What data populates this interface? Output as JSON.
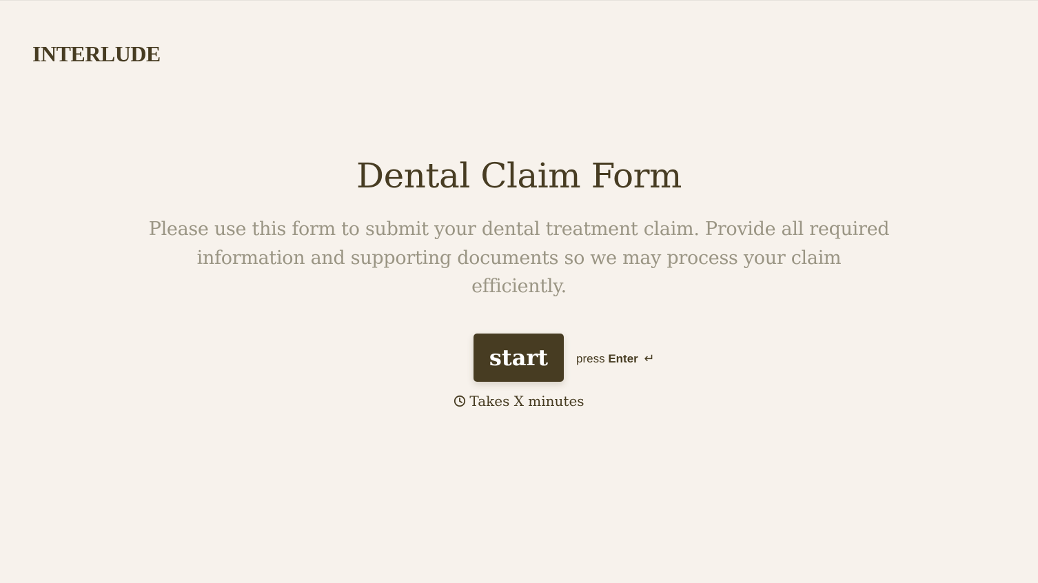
{
  "brand": {
    "logo_text": "INTERLUDE"
  },
  "form": {
    "title": "Dental Claim Form",
    "description": "Please use this form to submit your dental treatment claim. Provide all required information and supporting documents so we may process your claim efficiently."
  },
  "actions": {
    "start_label": "start",
    "hint_press": "press",
    "hint_key": "Enter",
    "hint_icon": "↵",
    "duration_text": "Takes X minutes",
    "duration_icon": "clock-icon"
  },
  "colors": {
    "background": "#f7f2ec",
    "primary": "#473c22",
    "muted_text": "#9a9584",
    "button_text": "#ffffff"
  }
}
